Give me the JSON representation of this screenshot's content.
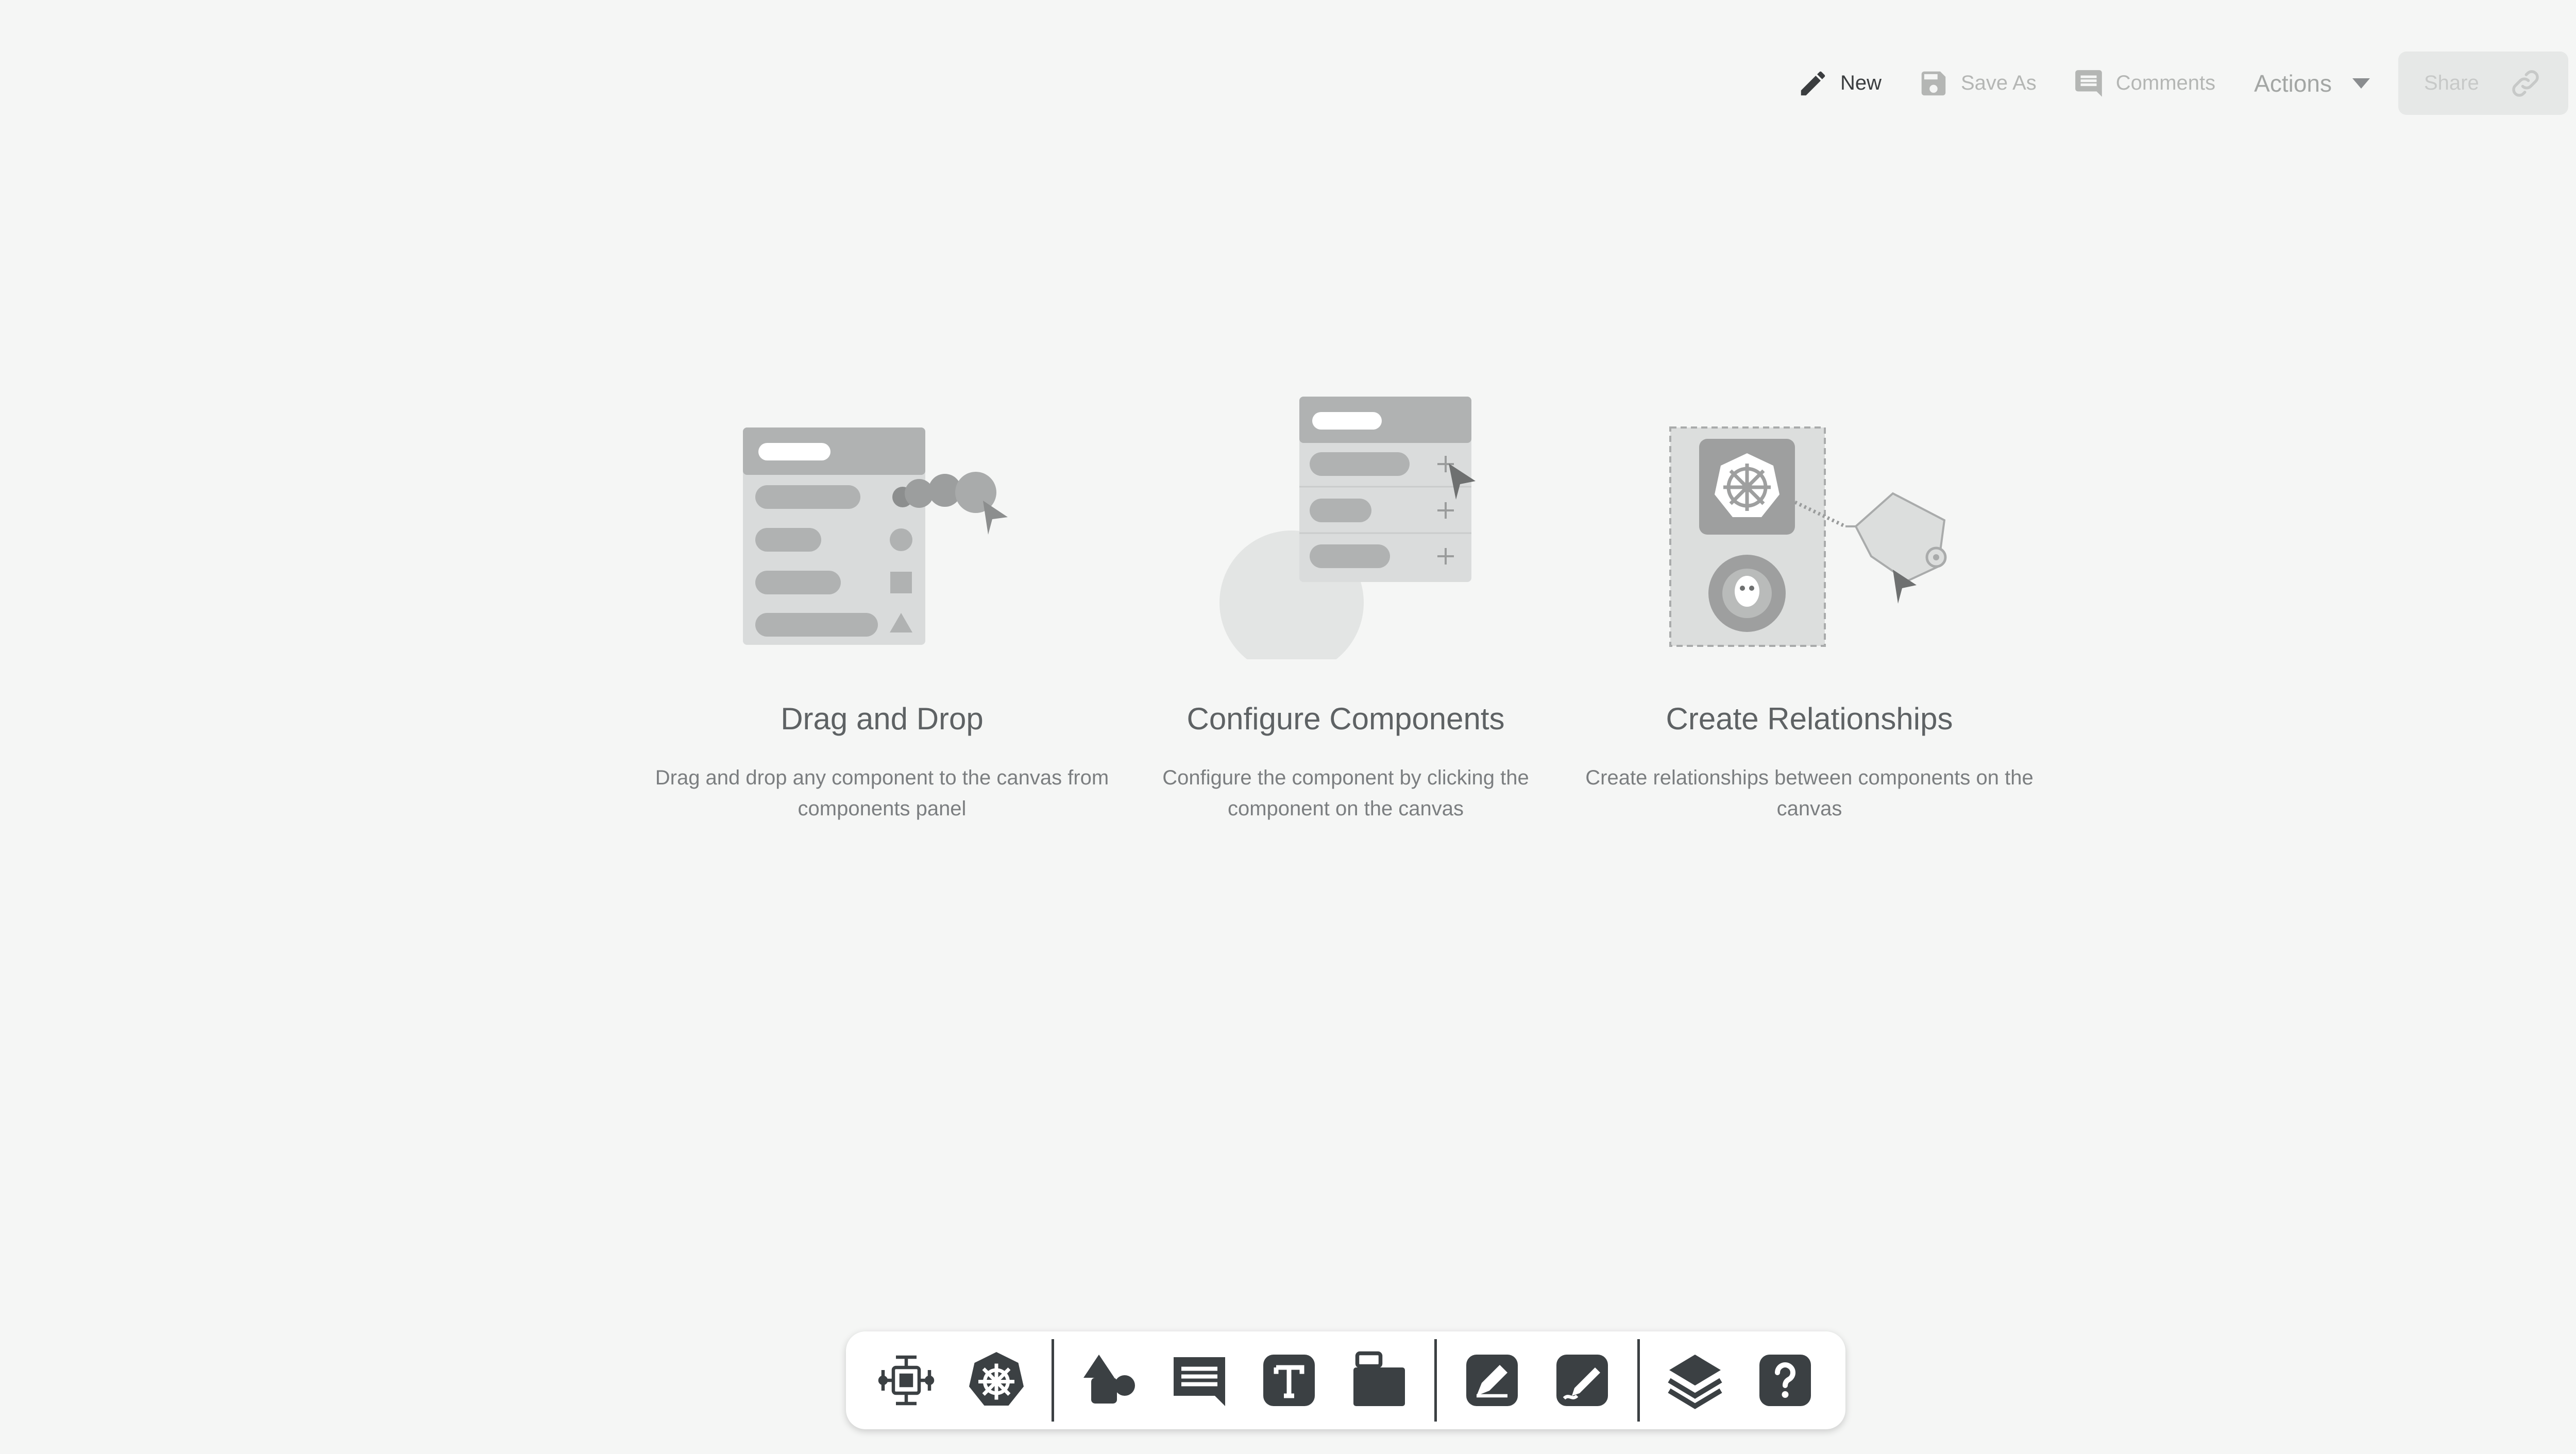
{
  "toolbar": {
    "new_label": "New",
    "save_as_label": "Save As",
    "comments_label": "Comments",
    "actions_label": "Actions",
    "share_label": "Share"
  },
  "features": [
    {
      "title": "Drag and Drop",
      "description": "Drag and drop any component to the canvas from components panel"
    },
    {
      "title": "Configure Components",
      "description": "Configure the component by clicking the component on the canvas"
    },
    {
      "title": "Create Relationships",
      "description": "Create relationships between components on the canvas"
    }
  ],
  "dock": {
    "items": [
      "components-icon",
      "kubernetes-icon",
      "shapes-icon",
      "comment-icon",
      "text-icon",
      "section-icon",
      "pen-icon",
      "freehand-icon",
      "layers-icon",
      "help-icon"
    ]
  },
  "colors": {
    "background": "#f5f6f5",
    "dock_icon": "#3b4043",
    "illustration_gray": "#b0b2b2"
  }
}
